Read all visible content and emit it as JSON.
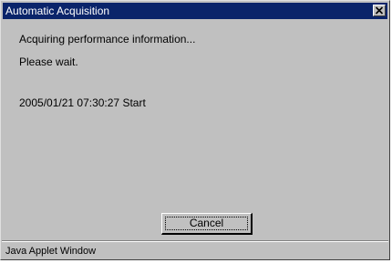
{
  "window": {
    "title": "Automatic Acquisition",
    "title_bar_color": "#0a246a",
    "background_color": "#c0c0c0"
  },
  "title_bar": {
    "close_icon": "close-icon"
  },
  "content": {
    "line1": "Acquiring performance information...",
    "line2": "Please wait.",
    "start_message": "2005/01/21 07:30:27 Start"
  },
  "buttons": {
    "cancel_label": "Cancel"
  },
  "status_bar": {
    "text": "Java Applet Window"
  }
}
